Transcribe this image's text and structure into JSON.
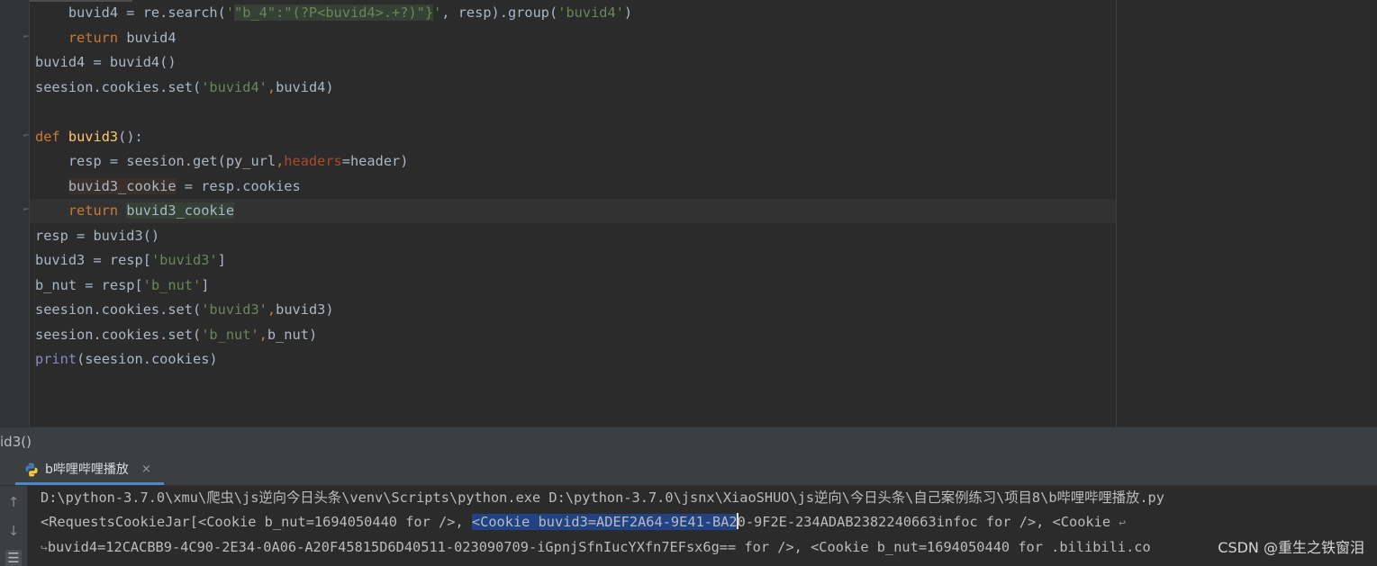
{
  "editor": {
    "lines": [
      "    buvid4 = re.search('\"b_4\":\"(?P<buvid4>.+?)\"}', resp).group('buvid4')",
      "    return buvid4",
      "buvid4 = buvid4()",
      "seesion.cookies.set('buvid4',buvid4)",
      "",
      "def buvid3():",
      "    resp = seesion.get(py_url,headers=header)",
      "    buvid3_cookie = resp.cookies",
      "    return buvid3_cookie",
      "resp = buvid3()",
      "buvid3 = resp['buvid3']",
      "b_nut = resp['b_nut']",
      "seesion.cookies.set('buvid3',buvid3)",
      "seesion.cookies.set('b_nut',b_nut)",
      "print(seesion.cookies)"
    ]
  },
  "breadcrumb": {
    "text": "id3()"
  },
  "run_panel": {
    "tab_label": "b哔哩哔哩播放",
    "tab_close": "×",
    "icons": [
      "python-icon",
      "close-icon",
      "arrow-up-icon",
      "arrow-down-icon",
      "soft-wrap-icon"
    ],
    "console": {
      "line1": "D:\\python-3.7.0\\xmu\\爬虫\\js逆向今日头条\\venv\\Scripts\\python.exe D:\\python-3.7.0\\jsnx\\XiaoSHUO\\js逆向\\今日头条\\自己案例练习\\项目8\\b哔哩哔哩播放.py",
      "line2_a": "<RequestsCookieJar[<Cookie b_nut=1694050440 for />, ",
      "line2_sel": "<Cookie buvid3=ADEF2A64-9E41-BA2",
      "line2_b": "0-9F2E-234ADAB2382240663infoc for />, <Cookie ",
      "line3": "buvid4=12CACBB9-4C90-2E34-0A06-A20F45815D6D40511-023090709-iGpnjSfnIucYXfn7EFsx6g== for />, <Cookie b_nut=1694050440 for .bilibili.co"
    },
    "watermark": "CSDN @重生之铁窗泪"
  },
  "colors": {
    "selection": "#214283",
    "tab_underline": "#4a88c7",
    "keyword": "#cc7832",
    "string": "#6a8759",
    "function": "#ffc66d"
  }
}
